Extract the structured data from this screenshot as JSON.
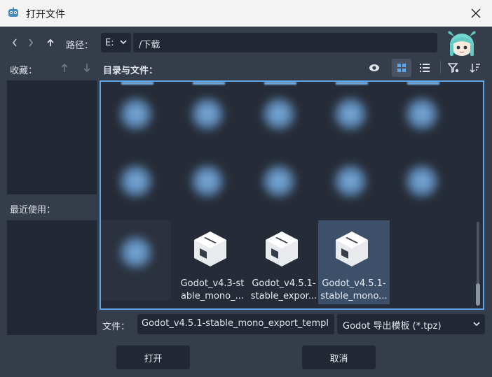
{
  "window": {
    "title": "打开文件"
  },
  "toolbar": {
    "path_label": "路径：",
    "drive_value": "E:",
    "path_value": "/下载",
    "favorites_label": "收藏：",
    "files_label": "目录与文件：",
    "recent_label": "最近使用："
  },
  "files": [
    {
      "name_line1": "Godot_v4.3-st",
      "name_line2": "able_mono_...",
      "selected": false
    },
    {
      "name_line1": "Godot_v4.5.1-",
      "name_line2": "stable_expor...",
      "selected": false
    },
    {
      "name_line1": "Godot_v4.5.1-",
      "name_line2": "stable_mono...",
      "selected": true
    }
  ],
  "footer": {
    "file_label": "文件：",
    "file_value": "Godot_v4.5.1-stable_mono_export_templ",
    "filter_value": "Godot 导出模板 (*.tpz)",
    "open_label": "打开",
    "cancel_label": "取消"
  },
  "colors": {
    "accent": "#5fa6e8",
    "background": "#363d4a",
    "panel": "#222833",
    "selected": "#3c5069"
  }
}
